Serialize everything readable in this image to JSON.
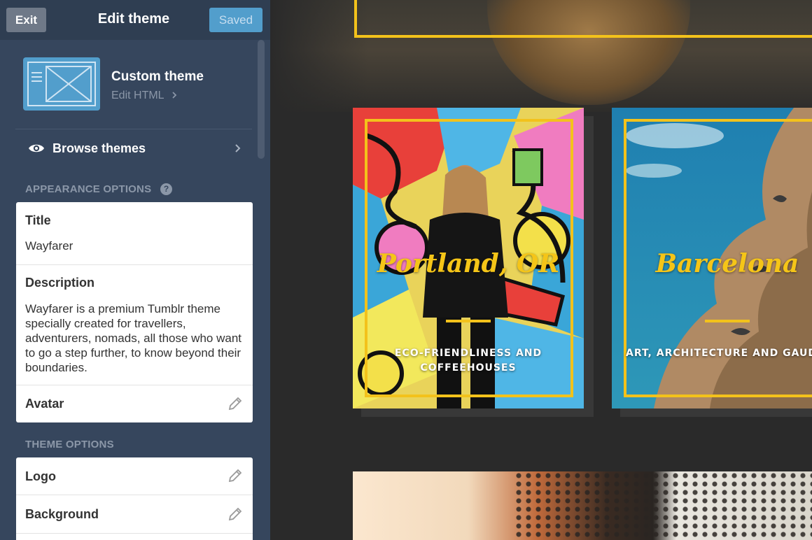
{
  "header": {
    "exit_label": "Exit",
    "title": "Edit theme",
    "saved_label": "Saved"
  },
  "theme": {
    "name": "Custom theme",
    "edit_html_label": "Edit HTML"
  },
  "browse": {
    "label": "Browse themes"
  },
  "appearance": {
    "section_label": "APPEARANCE OPTIONS",
    "help_glyph": "?",
    "title_label": "Title",
    "title_value": "Wayfarer",
    "description_label": "Description",
    "description_value": "Wayfarer is a premium Tumblr theme specially created for travellers, adventurers, nomads, all those who want to go a step further, to know beyond their boundaries.",
    "avatar_label": "Avatar"
  },
  "theme_options": {
    "section_label": "THEME OPTIONS",
    "items": [
      {
        "label": "Logo"
      },
      {
        "label": "Background"
      }
    ]
  },
  "preview": {
    "tiles": [
      {
        "city": "Portland, OR",
        "subtitle": "ECO-FRIENDLINESS AND COFFEEHOUSES"
      },
      {
        "city": "Barcelona",
        "subtitle": "ART, ARCHITECTURE AND GAUD"
      }
    ]
  },
  "colors": {
    "sidebar": "#36465d",
    "accent_blue": "#529ecc",
    "frame_yellow": "#f3c21b"
  },
  "icons": {
    "eye": "eye-icon",
    "chevron": "chevron-right-icon",
    "pencil": "pencil-icon",
    "help": "help-icon"
  }
}
